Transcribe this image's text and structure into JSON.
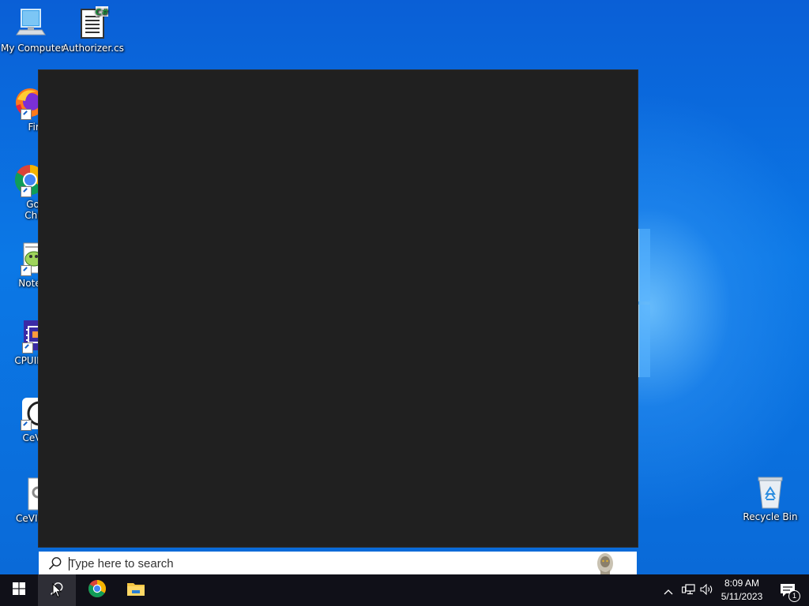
{
  "desktop": {
    "icons": [
      {
        "label": "My Computer",
        "icon": "computer-icon"
      },
      {
        "label": "Authorizer.cs",
        "icon": "csharp-file-icon"
      },
      {
        "label": "Firefo",
        "icon": "firefox-icon"
      },
      {
        "label": "Goog",
        "label2": "Chron",
        "icon": "chrome-icon"
      },
      {
        "label": "Notepa",
        "icon": "notepad-plus-icon"
      },
      {
        "label": "CPUID C",
        "icon": "cpuid-icon"
      },
      {
        "label": "CeVIO",
        "icon": "cevio-icon"
      },
      {
        "label": "CeVIO.S",
        "icon": "settings-file-icon"
      },
      {
        "label": "Recycle Bin",
        "icon": "recycle-bin-icon"
      }
    ]
  },
  "search": {
    "placeholder": "Type here to search",
    "value": ""
  },
  "taskbar": {
    "start_icon": "windows-logo-icon",
    "search_icon": "search-icon",
    "pinned": [
      "chrome-icon",
      "file-explorer-icon"
    ],
    "tray": [
      "chevron-up-icon",
      "network-icon",
      "volume-icon"
    ],
    "clock": {
      "time": "8:09 AM",
      "date": "5/11/2023"
    },
    "notifications": {
      "count": "1"
    }
  },
  "colors": {
    "desktop_blue": "#0b78e6",
    "flyout_bg": "#202020",
    "taskbar_bg": "#101018",
    "accent": "#0a6ad8"
  }
}
